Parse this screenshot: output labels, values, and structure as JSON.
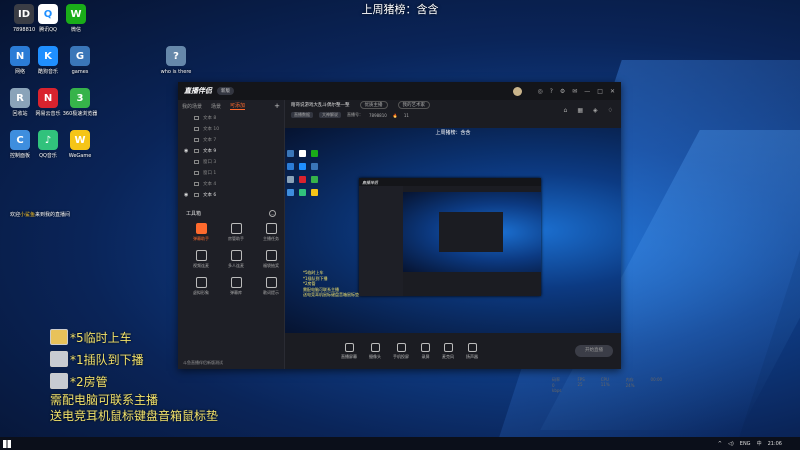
{
  "stream_title": "上周猪榜：含含",
  "desktop_icons": [
    {
      "label": "7898810",
      "glyph": "ID",
      "color": "#3a3d45",
      "name": "user-icon"
    },
    {
      "label": "腾讯QQ",
      "glyph": "Q",
      "color": "#ffffff",
      "name": "qq-icon"
    },
    {
      "label": "微信",
      "glyph": "W",
      "color": "#1aad19",
      "name": "wechat-icon"
    },
    {
      "label": "网络",
      "glyph": "N",
      "color": "#2b7cd6",
      "name": "network-icon"
    },
    {
      "label": "酷狗音乐",
      "glyph": "K",
      "color": "#1f8fff",
      "name": "kugou-icon"
    },
    {
      "label": "games",
      "glyph": "G",
      "color": "#3a76b8",
      "name": "games-folder-icon"
    },
    {
      "label": "who is there",
      "glyph": "?",
      "color": "#6688aa",
      "name": "whoisthere-icon"
    },
    {
      "label": "回收站",
      "glyph": "R",
      "color": "#8aa3b9",
      "name": "recycle-bin-icon"
    },
    {
      "label": "网易云音乐",
      "glyph": "N",
      "color": "#d9232e",
      "name": "netease-music-icon"
    },
    {
      "label": "360极速浏览器",
      "glyph": "3",
      "color": "#36b34a",
      "name": "browser-360-icon"
    },
    {
      "label": "控制面板",
      "glyph": "C",
      "color": "#3e8ede",
      "name": "control-panel-icon"
    },
    {
      "label": "QQ音乐",
      "glyph": "♪",
      "color": "#31c27c",
      "name": "qq-music-icon"
    },
    {
      "label": "WeGame",
      "glyph": "W",
      "color": "#f5c518",
      "name": "wegame-icon"
    }
  ],
  "welcome": {
    "prefix": "欢迎",
    "name": "小鲨鱼",
    "suffix": "来到我的直播间"
  },
  "app": {
    "logo": "直播伴侣",
    "version_badge": "新版",
    "tabs": [
      "我的场景",
      "场景",
      "可添加"
    ],
    "sources": [
      {
        "label": "文本 8",
        "visible": false
      },
      {
        "label": "文本 10",
        "visible": false
      },
      {
        "label": "文本 7",
        "visible": false
      },
      {
        "label": "文本 9",
        "visible": true
      },
      {
        "label": "窗口 3",
        "visible": false
      },
      {
        "label": "窗口 1",
        "visible": false
      },
      {
        "label": "文本 4",
        "visible": false
      },
      {
        "label": "文本 6",
        "visible": true
      }
    ],
    "tools_title": "工具箱",
    "tools": [
      {
        "label": "弹幕助手",
        "hot": true
      },
      {
        "label": "房管助手",
        "hot": false
      },
      {
        "label": "主播任务",
        "hot": false
      },
      {
        "label": "视频连麦",
        "hot": false
      },
      {
        "label": "多人连麦",
        "hot": false
      },
      {
        "label": "福袋抽奖",
        "hot": false
      },
      {
        "label": "虚拟形象",
        "hot": false
      },
      {
        "label": "弹幕库",
        "hot": false
      },
      {
        "label": "歌词提示",
        "hot": false
      }
    ],
    "status_left": "斗鱼直播伴侣新版测试",
    "title_row": {
      "room": "瞎哥说游戏大乱斗偶尔整一整",
      "pill1": "优质主播",
      "pill2": "我的艺术家"
    },
    "meta_row": {
      "tag1": "直播数据",
      "tag2": "大神解说",
      "room_label": "直播号：",
      "room_id": "7898810",
      "heat": "11"
    },
    "preview_title": "上周猪榜：含含",
    "inner_logo": "直播伴侣",
    "controls": [
      "直播屏幕",
      "摄像头",
      "手机投屏",
      "录屏",
      "麦克风",
      "扬声器"
    ],
    "start_button": "开始直播",
    "status_items": [
      "码率 0 kbps",
      "FPS 25",
      "CPU 11%",
      "内存 24%",
      "00:00"
    ],
    "preview_overlay": [
      "*5临时上车",
      "*1插队到下播",
      "*2房管",
      "需配电脑可联系主播",
      "送电竞耳机鼠标键盘音箱鼠标垫"
    ]
  },
  "overlay": {
    "line1": "*5临时上车",
    "line2": "*1插队到下播",
    "line3": "*2房管",
    "line4": "需配电脑可联系主播",
    "line5": "送电竞耳机鼠标键盘音箱鼠标垫"
  },
  "taskbar": {
    "lang": "ENG",
    "mode": "中",
    "time": "21:06"
  }
}
